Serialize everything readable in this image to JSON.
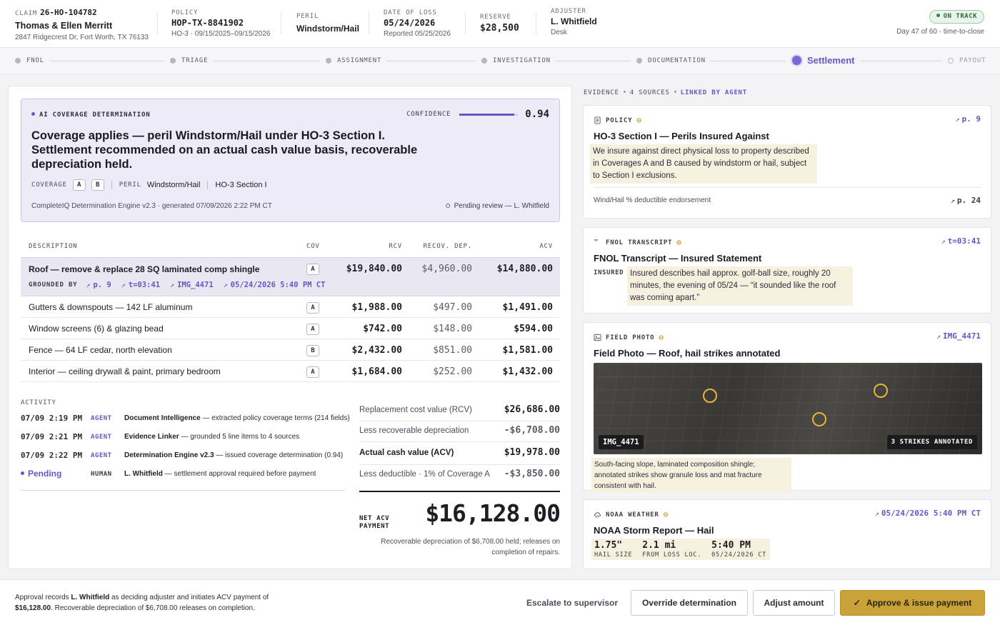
{
  "header": {
    "claim_label": "CLAIM",
    "claim_no": "26-HO-104782",
    "insured": "Thomas & Ellen Merritt",
    "address": "2847 Ridgecrest Dr, Fort Worth, TX 76133",
    "policy_label": "POLICY",
    "policy_no": "HOP-TX-8841902",
    "policy_term": "HO-3 · 09/15/2025–09/15/2026",
    "peril_label": "PERIL",
    "peril": "Windstorm/Hail",
    "dol_label": "DATE OF LOSS",
    "dol": "05/24/2026",
    "reported": "Reported 05/25/2026",
    "reserve_label": "RESERVE",
    "reserve": "$28,500",
    "adjuster_label": "ADJUSTER",
    "adjuster": "L. Whitfield",
    "adjuster_type": "Desk",
    "status": "ON TRACK",
    "days": "Day 47 of 60 · time-to-close"
  },
  "stepper": {
    "steps": [
      "FNOL",
      "TRIAGE",
      "ASSIGNMENT",
      "INVESTIGATION",
      "DOCUMENTATION",
      "Settlement",
      "PAYOUT"
    ],
    "active_index": 5
  },
  "determination": {
    "label": "AI COVERAGE DETERMINATION",
    "confidence_label": "CONFIDENCE",
    "confidence": "0.94",
    "confidence_value": 0.94,
    "headline": "Coverage applies — peril Windstorm/Hail under HO-3 Section I. Settlement recommended on an actual cash value basis, recoverable depreciation held.",
    "coverage_label": "COVERAGE",
    "coverage_chips": [
      "A",
      "B"
    ],
    "peril_label": "PERIL",
    "peril": "Windstorm/Hail",
    "section": "HO-3 Section I",
    "engine": "CompleteIQ Determination Engine v2.3 · generated 07/09/2026 2:22 PM CT",
    "pending": "Pending review — L. Whitfield"
  },
  "table": {
    "headers": {
      "desc": "DESCRIPTION",
      "cov": "COV",
      "rcv": "RCV",
      "dep": "RECOV. DEP.",
      "acv": "ACV"
    },
    "grounded_label": "GROUNDED BY",
    "grounded_refs": [
      "p. 9",
      "t=03:41",
      "IMG_4471",
      "05/24/2026 5:40 PM CT"
    ],
    "rows": [
      {
        "desc": "Roof — remove & replace 28 SQ laminated comp shingle",
        "cov": "A",
        "rcv": "$19,840.00",
        "dep": "$4,960.00",
        "acv": "$14,880.00"
      },
      {
        "desc": "Gutters & downspouts — 142 LF aluminum",
        "cov": "A",
        "rcv": "$1,988.00",
        "dep": "$497.00",
        "acv": "$1,491.00"
      },
      {
        "desc": "Window screens (6) & glazing bead",
        "cov": "A",
        "rcv": "$742.00",
        "dep": "$148.00",
        "acv": "$594.00"
      },
      {
        "desc": "Fence — 64 LF cedar, north elevation",
        "cov": "B",
        "rcv": "$2,432.00",
        "dep": "$851.00",
        "acv": "$1,581.00"
      },
      {
        "desc": "Interior — ceiling drywall & paint, primary bedroom",
        "cov": "A",
        "rcv": "$1,684.00",
        "dep": "$252.00",
        "acv": "$1,432.00"
      }
    ]
  },
  "activity": {
    "title": "ACTIVITY",
    "items": [
      {
        "time": "07/09 2:19 PM",
        "who": "AGENT",
        "actor": "Document Intelligence",
        "msg": " — extracted policy coverage terms (214 fields)"
      },
      {
        "time": "07/09 2:21 PM",
        "who": "AGENT",
        "actor": "Evidence Linker",
        "msg": " — grounded 5 line items to 4 sources"
      },
      {
        "time": "07/09 2:22 PM",
        "who": "AGENT",
        "actor": "Determination Engine v2.3",
        "msg": " — issued coverage determination (0.94)"
      },
      {
        "time": "Pending",
        "who": "HUMAN",
        "actor": "L. Whitfield",
        "msg": " — settlement approval required before payment"
      }
    ]
  },
  "summary": {
    "rows": [
      {
        "label": "Replacement cost value (RCV)",
        "value": "$26,686.00"
      },
      {
        "label": "Less recoverable depreciation",
        "value": "-$6,708.00"
      },
      {
        "label": "Actual cash value (ACV)",
        "value": "$19,978.00"
      },
      {
        "label": "Less deductible · 1% of Coverage A",
        "value": "-$3,850.00"
      }
    ],
    "net_label": "NET ACV PAYMENT",
    "net_value": "$16,128.00",
    "net_note": "Recoverable depreciation of $6,708.00 held; releases on completion of repairs."
  },
  "evidence": {
    "label": "EVIDENCE",
    "count": "4 SOURCES",
    "linked": "LINKED BY AGENT",
    "policy": {
      "type": "POLICY",
      "ref": "p. 9",
      "title": "HO-3 Section I — Perils Insured Against",
      "quote": "We insure against direct physical loss to property described in Coverages A and B caused by windstorm or hail, subject to Section I exclusions.",
      "foot": "Wind/Hail % deductible endorsement",
      "foot_ref": "p. 24"
    },
    "fnol": {
      "type": "FNOL TRANSCRIPT",
      "ref": "t=03:41",
      "title": "FNOL Transcript — Insured Statement",
      "speaker": "INSURED",
      "quote": "Insured describes hail approx. golf-ball size, roughly 20 minutes, the evening of 05/24 — “it sounded like the roof was coming apart.”"
    },
    "photo": {
      "type": "FIELD PHOTO",
      "ref": "IMG_4471",
      "title": "Field Photo — Roof, hail strikes annotated",
      "tag": "IMG_4471",
      "strikes": "3 STRIKES ANNOTATED",
      "caption": "South-facing slope, laminated composition shingle; annotated strikes show granule loss and mat fracture consistent with hail."
    },
    "noaa": {
      "type": "NOAA WEATHER",
      "ref": "05/24/2026 5:40 PM CT",
      "title": "NOAA Storm Report — Hail",
      "cells": [
        {
          "big": "1.75\"",
          "small": "HAIL SIZE"
        },
        {
          "big": "2.1 mi",
          "small": "FROM LOSS LOC."
        },
        {
          "big": "5:40 PM",
          "small": "05/24/2026 CT"
        }
      ]
    }
  },
  "footer": {
    "note_pre": "Approval records ",
    "note_name": "L. Whitfield",
    "note_mid": " as deciding adjuster and initiates ACV payment of ",
    "note_amt": "$16,128.00",
    "note_post": ". Recoverable depreciation of $6,708.00 releases on completion.",
    "escalate": "Escalate to supervisor",
    "override": "Override determination",
    "adjust": "Adjust amount",
    "approve": "Approve & issue payment"
  }
}
